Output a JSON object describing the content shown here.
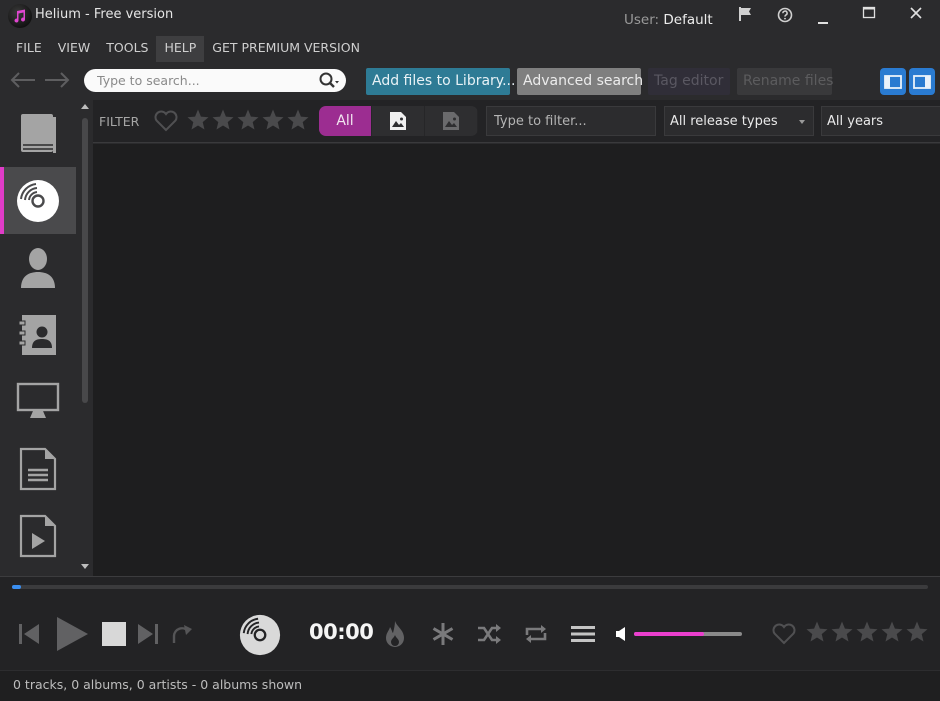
{
  "window": {
    "title": "Helium - Free version",
    "user_prefix": "User:",
    "user_name": "Default",
    "controls": [
      "flag-icon",
      "help-icon",
      "minimize-icon",
      "maximize-icon",
      "close-icon"
    ]
  },
  "menu": {
    "items": [
      {
        "label": "FILE",
        "active": false
      },
      {
        "label": "VIEW",
        "active": false
      },
      {
        "label": "TOOLS",
        "active": false
      },
      {
        "label": "HELP",
        "active": true
      },
      {
        "label": "GET PREMIUM VERSION",
        "active": false
      }
    ]
  },
  "toolbar": {
    "search_placeholder": "Type to search...",
    "search_value": "",
    "add_files_label": "Add files to Library...",
    "advanced_search_label": "Advanced search",
    "tag_editor_label": "Tag editor",
    "rename_files_label": "Rename files",
    "colors": {
      "add_files": "#2e7b95",
      "advanced_search": "#7f7f7f",
      "panel_toggle": "#2a7bd1"
    }
  },
  "sidebar": {
    "items": [
      {
        "icon": "book-icon",
        "active": false
      },
      {
        "icon": "disc-icon",
        "active": true
      },
      {
        "icon": "person-icon",
        "active": false
      },
      {
        "icon": "contact-card-icon",
        "active": false
      },
      {
        "icon": "monitor-icon",
        "active": false
      },
      {
        "icon": "document-icon",
        "active": false
      },
      {
        "icon": "video-file-icon",
        "active": false
      }
    ],
    "accent_color": "#e03cc8"
  },
  "filter": {
    "label": "FILTER",
    "rating_stars": 5,
    "segments": [
      {
        "label": "All",
        "active": true
      },
      {
        "label": "",
        "icon": "image-file-icon",
        "active": false
      },
      {
        "label": "",
        "icon": "image-file-dim-icon",
        "active": false
      }
    ],
    "filter_placeholder": "Type to filter...",
    "filter_value": "",
    "release_type": "All release types",
    "years": "All years",
    "segment_accent": "#9c2d91"
  },
  "player": {
    "time": "00:00",
    "seek_progress": 0.01,
    "volume": 0.65,
    "volume_color": "#ea3fce",
    "rating_stars": 5
  },
  "status": {
    "text": "0 tracks, 0 albums, 0 artists - 0 albums shown"
  }
}
